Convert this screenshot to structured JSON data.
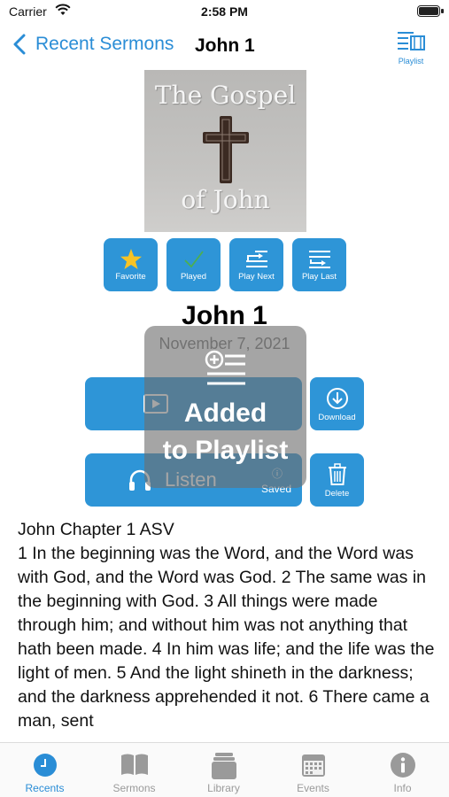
{
  "status_bar": {
    "carrier": "Carrier",
    "time": "2:58 PM"
  },
  "nav": {
    "back_label": "Recent Sermons",
    "title": "John  1",
    "playlist_label": "Playlist"
  },
  "cover": {
    "title_line1": "The Gospel",
    "title_line2": "of John"
  },
  "actions": [
    {
      "label": "Favorite",
      "icon": "star-icon"
    },
    {
      "label": "Played",
      "icon": "checkmark-icon"
    },
    {
      "label": "Play Next",
      "icon": "play-next-icon"
    },
    {
      "label": "Play Last",
      "icon": "play-last-icon"
    }
  ],
  "sermon": {
    "title": "John  1",
    "date": "November 7, 2021"
  },
  "media": {
    "watch_icon": "video-icon",
    "listen_label": "Listen",
    "listen_icon": "headphones-icon",
    "saved_label": "Saved",
    "saved_info_icon": "info-icon",
    "download_label": "Download",
    "download_icon": "download-icon",
    "delete_label": "Delete",
    "delete_icon": "trash-icon"
  },
  "toast": {
    "icon": "add-to-playlist-icon",
    "line1": "Added",
    "line2": "to Playlist"
  },
  "scripture": {
    "heading": "John Chapter 1 ASV",
    "body": "1 In the beginning was the Word, and the Word was with God, and the Word was God. 2 The same was in the beginning with God. 3 All things were made through him; and without him was not anything that hath been made. 4 In him was life; and the life was the light of men. 5 And the light shineth in the darkness; and the darkness apprehended it not. 6 There came a man, sent"
  },
  "tabs": [
    {
      "label": "Recents",
      "icon": "clock-icon",
      "active": true
    },
    {
      "label": "Sermons",
      "icon": "book-icon",
      "active": false
    },
    {
      "label": "Library",
      "icon": "library-icon",
      "active": false
    },
    {
      "label": "Events",
      "icon": "calendar-icon",
      "active": false
    },
    {
      "label": "Info",
      "icon": "info-icon",
      "active": false
    }
  ],
  "colors": {
    "accent": "#2e95d7",
    "link": "#2a8dd6",
    "star": "#f7c325",
    "check": "#4caf50"
  }
}
